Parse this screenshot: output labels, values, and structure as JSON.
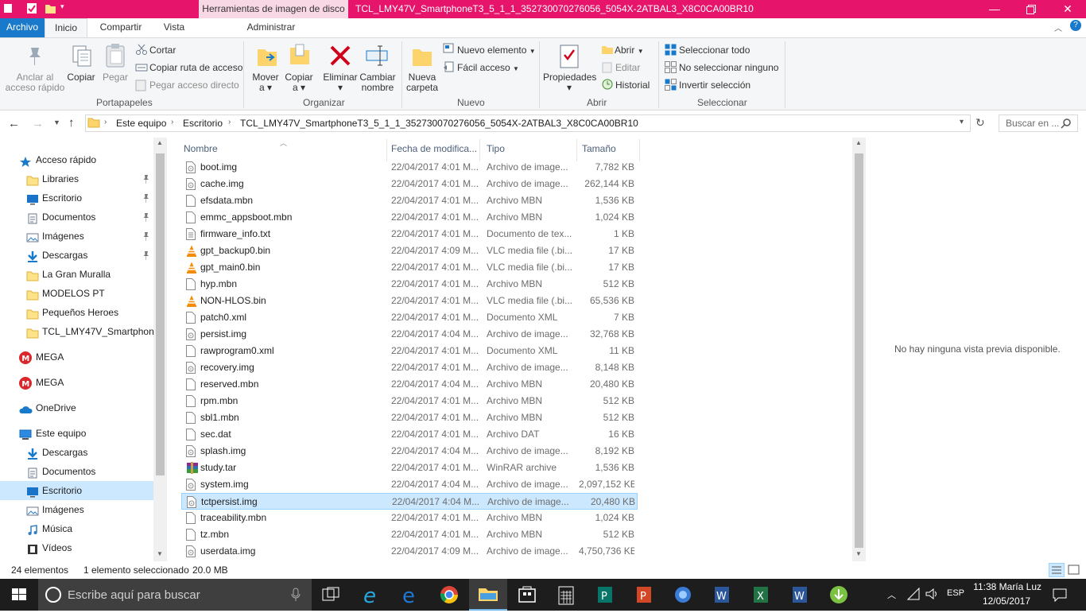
{
  "window": {
    "context_tab": "Herramientas de imagen de disco",
    "title": "TCL_LMY47V_SmartphoneT3_5_1_1_352730070276056_5054X-2ATBAL3_X8C0CA00BR10"
  },
  "ribbon_tabs": [
    "Archivo",
    "Inicio",
    "Compartir",
    "Vista",
    "Administrar"
  ],
  "ribbon": {
    "portapapeles": {
      "label": "Portapapeles",
      "anclar_line1": "Anclar al",
      "anclar_line2": "acceso rápido",
      "copiar": "Copiar",
      "pegar": "Pegar",
      "cortar": "Cortar",
      "copiar_ruta": "Copiar ruta de acceso",
      "pegar_acceso": "Pegar acceso directo"
    },
    "organizar": {
      "label": "Organizar",
      "mover_line1": "Mover",
      "mover_line2": "a",
      "copiar_line1": "Copiar",
      "copiar_line2": "a",
      "eliminar": "Eliminar",
      "cambiar_line1": "Cambiar",
      "cambiar_line2": "nombre"
    },
    "nuevo": {
      "label": "Nuevo",
      "carpeta_line1": "Nueva",
      "carpeta_line2": "carpeta",
      "nuevo_elemento": "Nuevo elemento",
      "facil_acceso": "Fácil acceso"
    },
    "abrir": {
      "label": "Abrir",
      "propiedades": "Propiedades",
      "abrir": "Abrir",
      "editar": "Editar",
      "historial": "Historial"
    },
    "seleccionar": {
      "label": "Seleccionar",
      "todo": "Seleccionar todo",
      "ninguno": "No seleccionar ninguno",
      "invertir": "Invertir selección"
    }
  },
  "address": {
    "crumbs": [
      "Este equipo",
      "Escritorio",
      "TCL_LMY47V_SmartphoneT3_5_1_1_352730070276056_5054X-2ATBAL3_X8C0CA00BR10"
    ],
    "search_placeholder": "Buscar en ..."
  },
  "nav": [
    {
      "label": "Acceso rápido",
      "icon": "star-icon",
      "indent": 0,
      "pinned": false
    },
    {
      "label": "Libraries",
      "icon": "folder-icon",
      "indent": 1,
      "pinned": true
    },
    {
      "label": "Escritorio",
      "icon": "desktop-icon",
      "indent": 1,
      "pinned": true
    },
    {
      "label": "Documentos",
      "icon": "documents-icon",
      "indent": 1,
      "pinned": true
    },
    {
      "label": "Imágenes",
      "icon": "pictures-icon",
      "indent": 1,
      "pinned": true
    },
    {
      "label": "Descargas",
      "icon": "download-icon",
      "indent": 1,
      "pinned": true
    },
    {
      "label": "La Gran Muralla",
      "icon": "folder-icon",
      "indent": 1,
      "pinned": false
    },
    {
      "label": "MODELOS PT",
      "icon": "folder-icon",
      "indent": 1,
      "pinned": false
    },
    {
      "label": "Pequeños Heroes",
      "icon": "folder-icon",
      "indent": 1,
      "pinned": false
    },
    {
      "label": "TCL_LMY47V_SmartphoneT",
      "icon": "folder-icon",
      "indent": 1,
      "pinned": false
    },
    {
      "label": "MEGA",
      "icon": "mega-icon",
      "indent": 0,
      "pinned": false
    },
    {
      "label": "MEGA",
      "icon": "mega-icon",
      "indent": 0,
      "pinned": false
    },
    {
      "label": "OneDrive",
      "icon": "onedrive-icon",
      "indent": 0,
      "pinned": false
    },
    {
      "label": "Este equipo",
      "icon": "computer-icon",
      "indent": 0,
      "pinned": false
    },
    {
      "label": "Descargas",
      "icon": "download-icon",
      "indent": 1,
      "pinned": false
    },
    {
      "label": "Documentos",
      "icon": "documents-icon",
      "indent": 1,
      "pinned": false
    },
    {
      "label": "Escritorio",
      "icon": "desktop-icon",
      "indent": 1,
      "pinned": false,
      "selected": true
    },
    {
      "label": "Imágenes",
      "icon": "pictures-icon",
      "indent": 1,
      "pinned": false
    },
    {
      "label": "Música",
      "icon": "music-icon",
      "indent": 1,
      "pinned": false
    },
    {
      "label": "Vídeos",
      "icon": "video-icon",
      "indent": 1,
      "pinned": false
    }
  ],
  "columns": {
    "name": "Nombre",
    "date": "Fecha de modifica...",
    "type": "Tipo",
    "size": "Tamaño"
  },
  "files": [
    {
      "name": "boot.img",
      "date": "22/04/2017 4:01 M...",
      "type": "Archivo de image...",
      "size": "7,782 KB",
      "icon": "disk-image-icon"
    },
    {
      "name": "cache.img",
      "date": "22/04/2017 4:01 M...",
      "type": "Archivo de image...",
      "size": "262,144 KB",
      "icon": "disk-image-icon"
    },
    {
      "name": "efsdata.mbn",
      "date": "22/04/2017 4:01 M...",
      "type": "Archivo MBN",
      "size": "1,536 KB",
      "icon": "file-icon"
    },
    {
      "name": "emmc_appsboot.mbn",
      "date": "22/04/2017 4:01 M...",
      "type": "Archivo MBN",
      "size": "1,024 KB",
      "icon": "file-icon"
    },
    {
      "name": "firmware_info.txt",
      "date": "22/04/2017 4:01 M...",
      "type": "Documento de tex...",
      "size": "1 KB",
      "icon": "text-file-icon"
    },
    {
      "name": "gpt_backup0.bin",
      "date": "22/04/2017 4:09 M...",
      "type": "VLC media file (.bi...",
      "size": "17 KB",
      "icon": "vlc-icon"
    },
    {
      "name": "gpt_main0.bin",
      "date": "22/04/2017 4:01 M...",
      "type": "VLC media file (.bi...",
      "size": "17 KB",
      "icon": "vlc-icon"
    },
    {
      "name": "hyp.mbn",
      "date": "22/04/2017 4:01 M...",
      "type": "Archivo MBN",
      "size": "512 KB",
      "icon": "file-icon"
    },
    {
      "name": "NON-HLOS.bin",
      "date": "22/04/2017 4:01 M...",
      "type": "VLC media file (.bi...",
      "size": "65,536 KB",
      "icon": "vlc-icon"
    },
    {
      "name": "patch0.xml",
      "date": "22/04/2017 4:01 M...",
      "type": "Documento XML",
      "size": "7 KB",
      "icon": "file-icon"
    },
    {
      "name": "persist.img",
      "date": "22/04/2017 4:04 M...",
      "type": "Archivo de image...",
      "size": "32,768 KB",
      "icon": "disk-image-icon"
    },
    {
      "name": "rawprogram0.xml",
      "date": "22/04/2017 4:01 M...",
      "type": "Documento XML",
      "size": "11 KB",
      "icon": "file-icon"
    },
    {
      "name": "recovery.img",
      "date": "22/04/2017 4:01 M...",
      "type": "Archivo de image...",
      "size": "8,148 KB",
      "icon": "disk-image-icon"
    },
    {
      "name": "reserved.mbn",
      "date": "22/04/2017 4:04 M...",
      "type": "Archivo MBN",
      "size": "20,480 KB",
      "icon": "file-icon"
    },
    {
      "name": "rpm.mbn",
      "date": "22/04/2017 4:01 M...",
      "type": "Archivo MBN",
      "size": "512 KB",
      "icon": "file-icon"
    },
    {
      "name": "sbl1.mbn",
      "date": "22/04/2017 4:01 M...",
      "type": "Archivo MBN",
      "size": "512 KB",
      "icon": "file-icon"
    },
    {
      "name": "sec.dat",
      "date": "22/04/2017 4:01 M...",
      "type": "Archivo DAT",
      "size": "16 KB",
      "icon": "file-icon"
    },
    {
      "name": "splash.img",
      "date": "22/04/2017 4:04 M...",
      "type": "Archivo de image...",
      "size": "8,192 KB",
      "icon": "disk-image-icon"
    },
    {
      "name": "study.tar",
      "date": "22/04/2017 4:01 M...",
      "type": "WinRAR archive",
      "size": "1,536 KB",
      "icon": "winrar-icon"
    },
    {
      "name": "system.img",
      "date": "22/04/2017 4:04 M...",
      "type": "Archivo de image...",
      "size": "2,097,152 KB",
      "icon": "disk-image-icon"
    },
    {
      "name": "tctpersist.img",
      "date": "22/04/2017 4:04 M...",
      "type": "Archivo de image...",
      "size": "20,480 KB",
      "icon": "disk-image-icon",
      "selected": true
    },
    {
      "name": "traceability.mbn",
      "date": "22/04/2017 4:01 M...",
      "type": "Archivo MBN",
      "size": "1,024 KB",
      "icon": "file-icon"
    },
    {
      "name": "tz.mbn",
      "date": "22/04/2017 4:01 M...",
      "type": "Archivo MBN",
      "size": "512 KB",
      "icon": "file-icon"
    },
    {
      "name": "userdata.img",
      "date": "22/04/2017 4:09 M...",
      "type": "Archivo de image...",
      "size": "4,750,736 KB",
      "icon": "disk-image-icon"
    }
  ],
  "preview": {
    "message": "No hay ninguna vista previa disponible."
  },
  "status": {
    "count": "24 elementos",
    "selection": "1 elemento seleccionado",
    "size": "20.0 MB"
  },
  "taskbar": {
    "search_placeholder": "Escribe aquí para buscar",
    "apps": [
      "task-view-icon",
      "internet-explorer-icon",
      "edge-icon",
      "chrome-icon",
      "file-explorer-icon",
      "store-icon",
      "calculator-icon",
      "publisher-icon",
      "powerpoint-icon",
      "app-icon",
      "word-icon",
      "excel-icon",
      "word-icon",
      "download-manager-icon"
    ],
    "lang": "ESP",
    "time": "11:38 María Luz",
    "date": "12/05/2017"
  },
  "colors": {
    "title_bar": "#e6146a",
    "file_tab": "#1979ca",
    "selection": "#cce8ff",
    "taskbar": "#1d1d1d"
  }
}
